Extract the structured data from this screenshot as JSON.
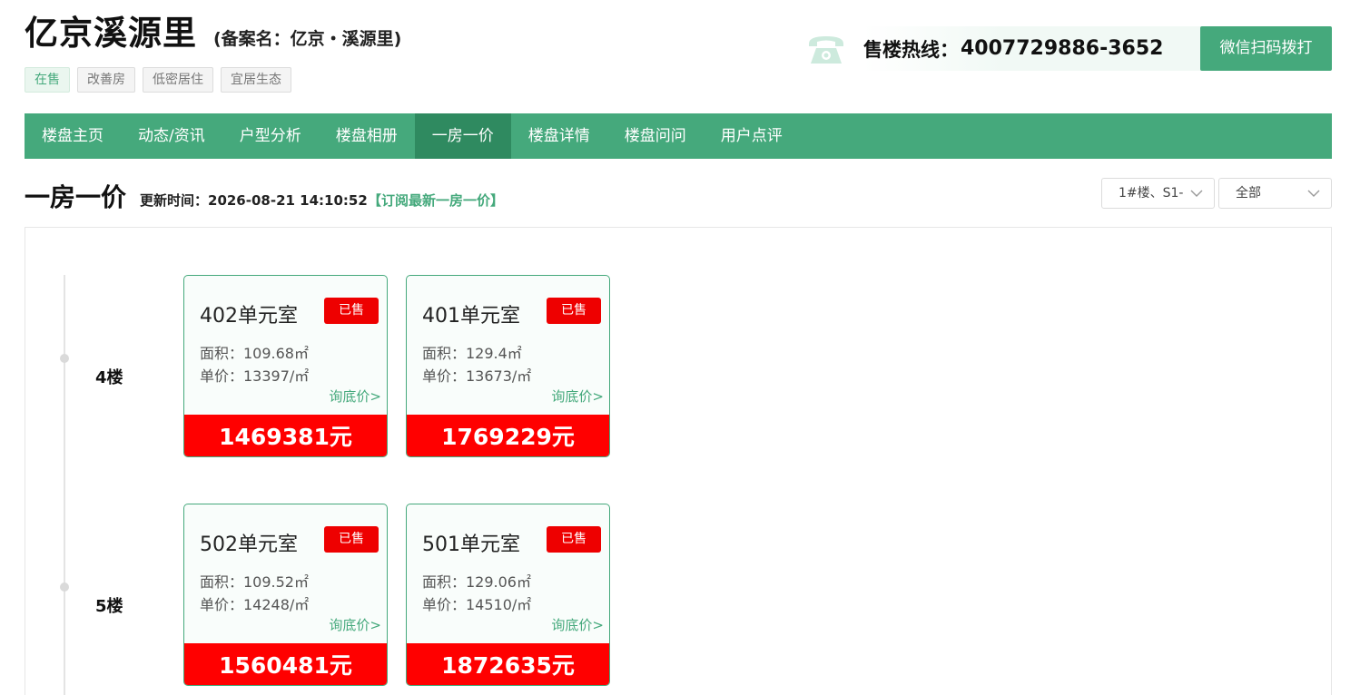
{
  "header": {
    "title": "亿京溪源里",
    "alias": "(备案名：亿京・溪源里)",
    "tags": [
      "在售",
      "改善房",
      "低密居住",
      "宜居生态"
    ],
    "hotline_label": "售楼热线：",
    "hotline_number": "4007729886-3652",
    "wechat_button": "微信扫码拨打"
  },
  "nav": {
    "items": [
      "楼盘主页",
      "动态/资讯",
      "户型分析",
      "楼盘相册",
      "一房一价",
      "楼盘详情",
      "楼盘问问",
      "用户点评"
    ],
    "active_index": 4
  },
  "section": {
    "title": "一房一价",
    "update_label": "更新时间：2026-08-21 14:10:52",
    "subscribe_link": "【订阅最新一房一价】",
    "building_select": "1#楼、S1-",
    "filter_select": "全部"
  },
  "floors": [
    {
      "label": "4楼",
      "units": [
        {
          "room": "402单元室",
          "status": "已售",
          "area": "面积：109.68㎡",
          "unit_price": "单价：13397/㎡",
          "ask": "询底价>",
          "total": "1469381元"
        },
        {
          "room": "401单元室",
          "status": "已售",
          "area": "面积：129.4㎡",
          "unit_price": "单价：13673/㎡",
          "ask": "询底价>",
          "total": "1769229元"
        }
      ]
    },
    {
      "label": "5楼",
      "units": [
        {
          "room": "502单元室",
          "status": "已售",
          "area": "面积：109.52㎡",
          "unit_price": "单价：14248/㎡",
          "ask": "询底价>",
          "total": "1560481元"
        },
        {
          "room": "501单元室",
          "status": "已售",
          "area": "面积：129.06㎡",
          "unit_price": "单价：14510/㎡",
          "ask": "询底价>",
          "total": "1872635元"
        }
      ]
    }
  ],
  "colors": {
    "brand_green": "#45a97c",
    "nav_active": "#2f8a60",
    "sold_red": "#ee0000",
    "price_red": "#ff0000"
  }
}
